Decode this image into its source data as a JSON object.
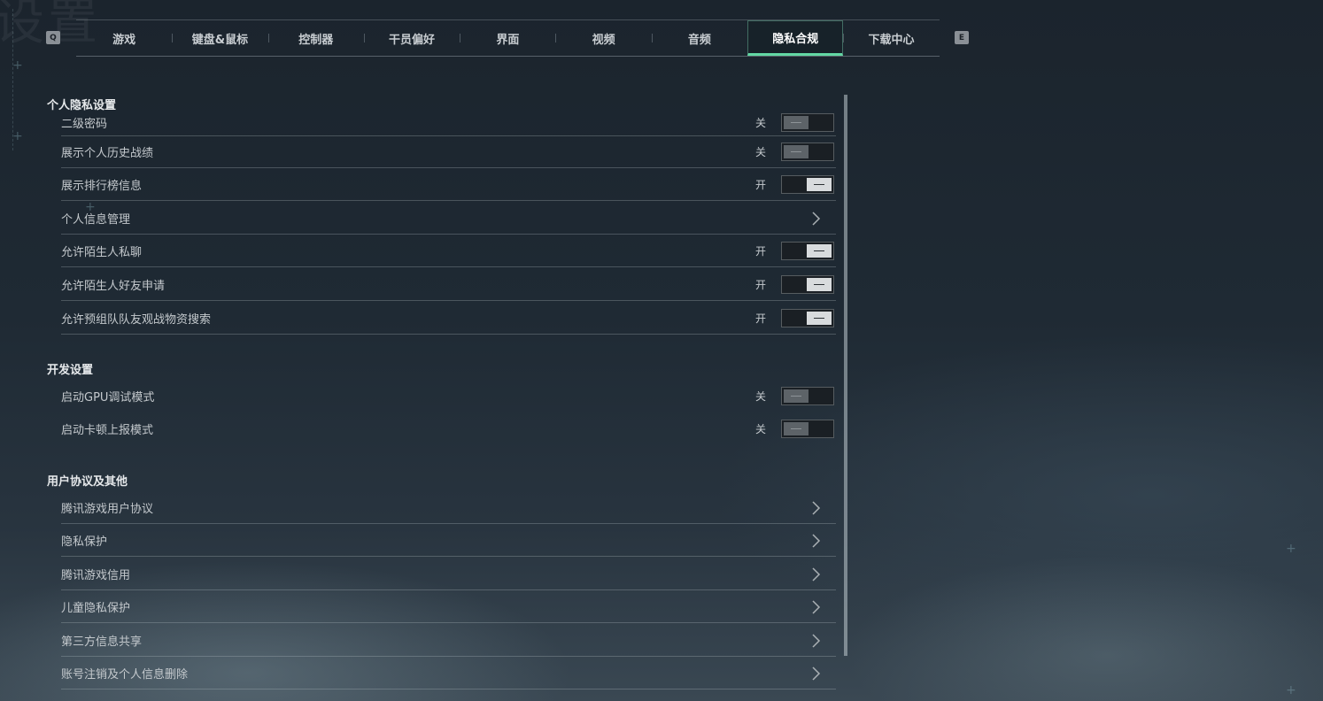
{
  "bg_title": "设置",
  "tabs": [
    {
      "label": "游戏",
      "active": false
    },
    {
      "label": "键盘&鼠标",
      "active": false
    },
    {
      "label": "控制器",
      "active": false
    },
    {
      "label": "干员偏好",
      "active": false
    },
    {
      "label": "界面",
      "active": false
    },
    {
      "label": "视频",
      "active": false
    },
    {
      "label": "音频",
      "active": false
    },
    {
      "label": "隐私合规",
      "active": true
    },
    {
      "label": "下载中心",
      "active": false
    }
  ],
  "keys": {
    "left": "Q",
    "right": "E"
  },
  "sections": {
    "privacy": {
      "title": "个人隐私设置",
      "rows": [
        {
          "label": "二级密码",
          "state": "关",
          "type": "toggle",
          "on": false
        },
        {
          "label": "展示个人历史战绩",
          "state": "关",
          "type": "toggle",
          "on": false
        },
        {
          "label": "展示排行榜信息",
          "state": "开",
          "type": "toggle",
          "on": true
        },
        {
          "label": "个人信息管理",
          "state": "",
          "type": "link"
        },
        {
          "label": "允许陌生人私聊",
          "state": "开",
          "type": "toggle",
          "on": true
        },
        {
          "label": "允许陌生人好友申请",
          "state": "开",
          "type": "toggle",
          "on": true
        },
        {
          "label": "允许预组队队友观战物资搜索",
          "state": "开",
          "type": "toggle",
          "on": true
        }
      ]
    },
    "dev": {
      "title": "开发设置",
      "rows": [
        {
          "label": "启动GPU调试模式",
          "state": "关",
          "type": "toggle",
          "on": false
        },
        {
          "label": "启动卡顿上报模式",
          "state": "关",
          "type": "toggle",
          "on": false
        }
      ]
    },
    "agreements": {
      "title": "用户协议及其他",
      "rows": [
        {
          "label": "腾讯游戏用户协议",
          "type": "link"
        },
        {
          "label": "隐私保护",
          "type": "link"
        },
        {
          "label": "腾讯游戏信用",
          "type": "link"
        },
        {
          "label": "儿童隐私保护",
          "type": "link"
        },
        {
          "label": "第三方信息共享",
          "type": "link"
        },
        {
          "label": "账号注销及个人信息删除",
          "type": "link"
        }
      ]
    }
  }
}
